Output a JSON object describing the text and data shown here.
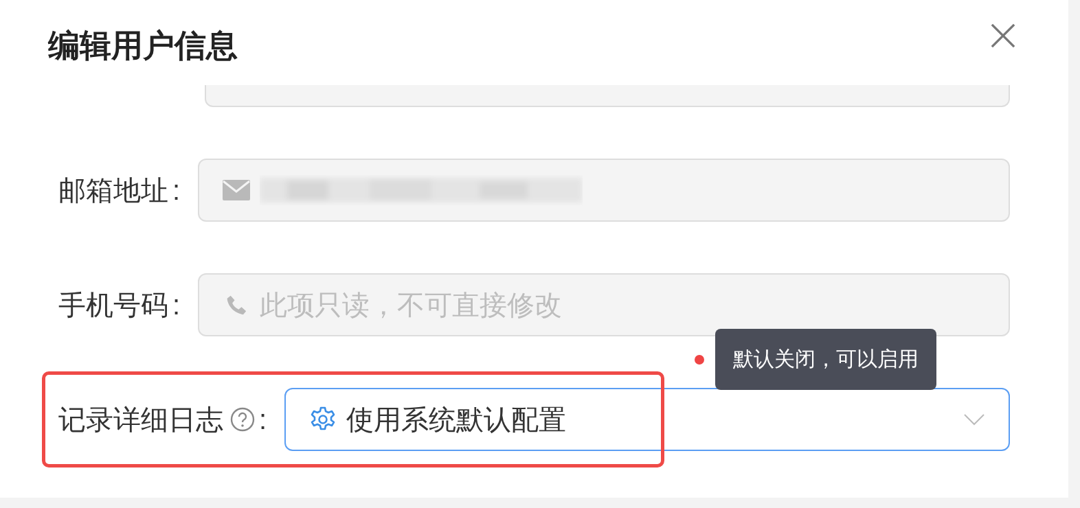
{
  "dialog": {
    "title": "编辑用户信息"
  },
  "fields": [
    {
      "kind": "cut",
      "disabled": true
    },
    {
      "kind": "input",
      "label": "邮箱地址",
      "colon": ":",
      "disabled": true
    },
    {
      "kind": "input",
      "label": "手机号码",
      "colon": ":",
      "disabled": true,
      "placeholder": "此项只读，不可直接修改"
    },
    {
      "kind": "select",
      "label": "记录详细日志",
      "help": true,
      "colon": ":",
      "focused": true,
      "value": "使用系统默认配置",
      "highlighted": true,
      "tooltip": "默认关闭，可以启用"
    }
  ]
}
